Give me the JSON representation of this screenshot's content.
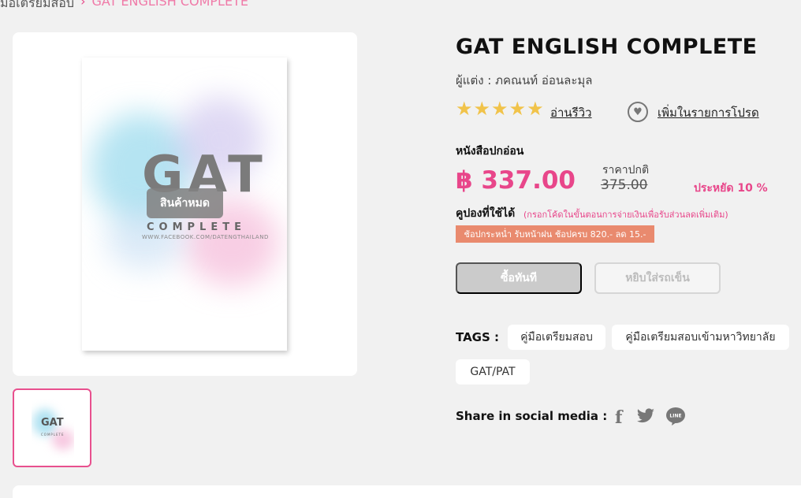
{
  "breadcrumb": {
    "previous": "มือเตรียมสอบ",
    "current": "GAT ENGLISH COMPLETE"
  },
  "product": {
    "cover_title": "GAT",
    "cover_subtitle": "COMPLETE",
    "cover_url": "WWW.FACEBOOK.COM/DATENGTHAILAND",
    "thumb_title": "GAT",
    "thumb_subtitle": "COMPLETE",
    "soldout_label": "สินค้าหมด",
    "title": "GAT ENGLISH COMPLETE",
    "author": "ผู้แต่ง : ภคณนท์ อ่อนละมุล",
    "rating_stars": 5,
    "review_link": "อ่านรีวิว",
    "wishlist_link": "เพิ่มในรายการโปรด",
    "format": "หนังสือปกอ่อน",
    "price": "฿ 337.00",
    "normal_price_label": "ราคาปกติ",
    "normal_price": "375.00",
    "saving": "ประหยัด 10 %",
    "coupon_label": "คูปองที่ใช้ได้",
    "coupon_note": "(กรอกโค้ดในขั้นตอนการจ่ายเงินเพื่อรับส่วนลดเพิ่มเติม)",
    "coupon_tag": "ช้อปกระหน่ำ รับหน้าฝน ช้อปครบ 820.- ลด 15.-",
    "buy_now": "ซื้อทันที",
    "add_to_cart": "หยิบใส่รถเข็น",
    "tags_label": "TAGS :",
    "tags": [
      "คู่มือเตรียมสอบ",
      "คู่มือเตรียมสอบเข้ามหาวิทยาลัย",
      "GAT/PAT"
    ],
    "share_label": "Share in social media :"
  },
  "icons": {
    "star": "star-icon",
    "heart": "heart-icon",
    "facebook": "facebook-icon",
    "twitter": "twitter-icon",
    "line": "line-icon",
    "chevron": "chevron-right-icon"
  },
  "colors": {
    "accent": "#e8468a",
    "star": "#f1c34a",
    "coupon": "#e98a6e",
    "disabled": "#cbcbcb"
  }
}
